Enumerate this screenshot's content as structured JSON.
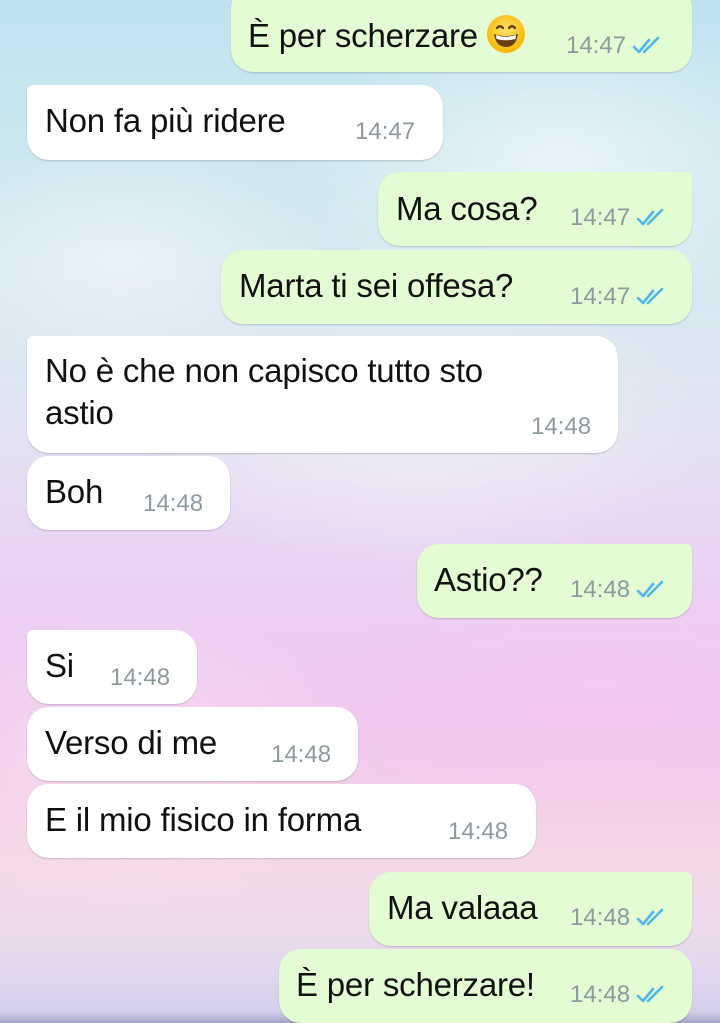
{
  "conversation": {
    "messages": [
      {
        "direction": "outgoing",
        "text": "È per scherzare",
        "emoji": "grinning-face",
        "time": "14:47",
        "status": "read"
      },
      {
        "direction": "incoming",
        "text": "Non fa più ridere",
        "time": "14:47"
      },
      {
        "direction": "outgoing",
        "text": "Ma cosa?",
        "time": "14:47",
        "status": "read"
      },
      {
        "direction": "outgoing",
        "text": "Marta ti sei offesa?",
        "time": "14:47",
        "status": "read"
      },
      {
        "direction": "incoming",
        "text_line1": "No è che non capisco tutto sto",
        "text_line2": "astio",
        "time": "14:48"
      },
      {
        "direction": "incoming",
        "text": "Boh",
        "time": "14:48"
      },
      {
        "direction": "outgoing",
        "text": "Astio??",
        "time": "14:48",
        "status": "read"
      },
      {
        "direction": "incoming",
        "text": "Si",
        "time": "14:48"
      },
      {
        "direction": "incoming",
        "text": "Verso di me",
        "time": "14:48"
      },
      {
        "direction": "incoming",
        "text": "E il mio fisico in forma",
        "time": "14:48"
      },
      {
        "direction": "outgoing",
        "text": "Ma valaaa",
        "time": "14:48",
        "status": "read"
      },
      {
        "direction": "outgoing",
        "text": "È per scherzare!",
        "time": "14:48",
        "status": "read"
      }
    ]
  },
  "colors": {
    "outgoing_bubble": "#e4fcd3",
    "incoming_bubble": "#ffffff",
    "timestamp": "#8e9a9e",
    "read_ticks": "#4fb6ec"
  }
}
